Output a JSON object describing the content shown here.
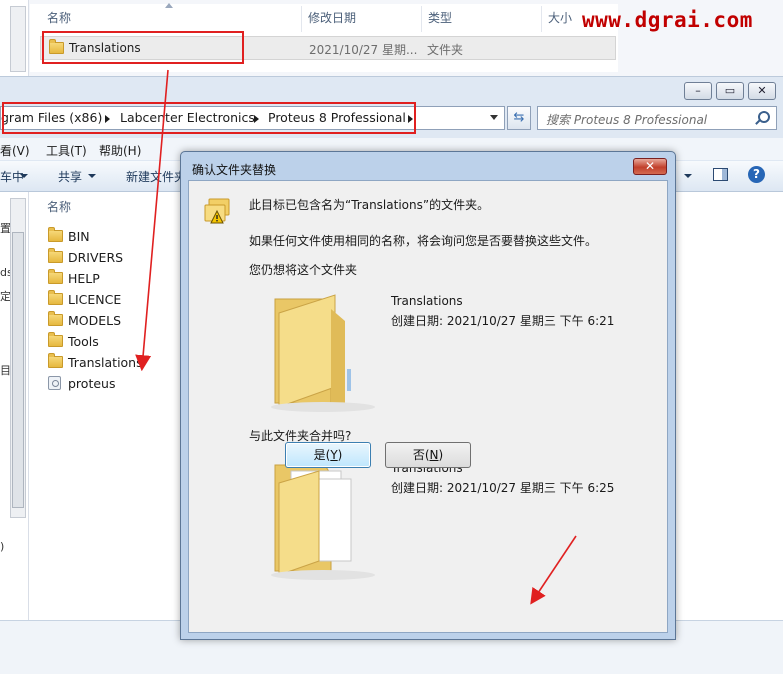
{
  "watermark": "www.dgrai.com",
  "top_window": {
    "columns": {
      "name": "名称",
      "date": "修改日期",
      "type": "类型",
      "size": "大小"
    },
    "row": {
      "name": "Translations",
      "date": "2021/10/27 星期...",
      "type": "文件夹"
    }
  },
  "main_window": {
    "caption_buttons": {
      "minimize": "–",
      "maximize": "▭",
      "close": "✕"
    },
    "breadcrumb": [
      "gram Files (x86)",
      "Labcenter Electronics",
      "Proteus 8 Professional"
    ],
    "search_placeholder": "搜索 Proteus 8 Professional",
    "menu": [
      "看(V)",
      "工具(T)",
      "帮助(H)"
    ],
    "toolbar": {
      "left_partial": "车中",
      "share": "共享",
      "new_folder": "新建文件夹"
    },
    "nav_partial": [
      "置",
      "ds",
      "定间",
      "目",
      ")"
    ],
    "column_name": "名称",
    "files": [
      {
        "name": "BIN",
        "kind": "folder"
      },
      {
        "name": "DRIVERS",
        "kind": "folder"
      },
      {
        "name": "HELP",
        "kind": "folder"
      },
      {
        "name": "LICENCE",
        "kind": "folder"
      },
      {
        "name": "MODELS",
        "kind": "folder"
      },
      {
        "name": "Tools",
        "kind": "folder"
      },
      {
        "name": "Translations",
        "kind": "folder"
      },
      {
        "name": "proteus",
        "kind": "file"
      }
    ]
  },
  "dialog": {
    "title": "确认文件夹替换",
    "close": "✕",
    "message": "此目标已包含名为“Translations”的文件夹。",
    "explanation": "如果任何文件使用相同的名称，将会询问您是否要替换这些文件。",
    "question": "您仍想将这个文件夹",
    "existing": {
      "name": "Translations",
      "created": "创建日期: 2021/10/27 星期三 下午 6:21"
    },
    "merge_prompt": "与此文件夹合并吗?",
    "incoming": {
      "name": "Translations",
      "created": "创建日期: 2021/10/27 星期三 下午 6:25"
    },
    "yes": {
      "label": "是(",
      "key": "Y",
      "end": ")"
    },
    "no": {
      "label": "否(",
      "key": "N",
      "end": ")"
    }
  },
  "colors": {
    "annotation_red": "#e02020",
    "dialog_frame": "#bcd1ea",
    "watermark_red": "#c10000"
  }
}
